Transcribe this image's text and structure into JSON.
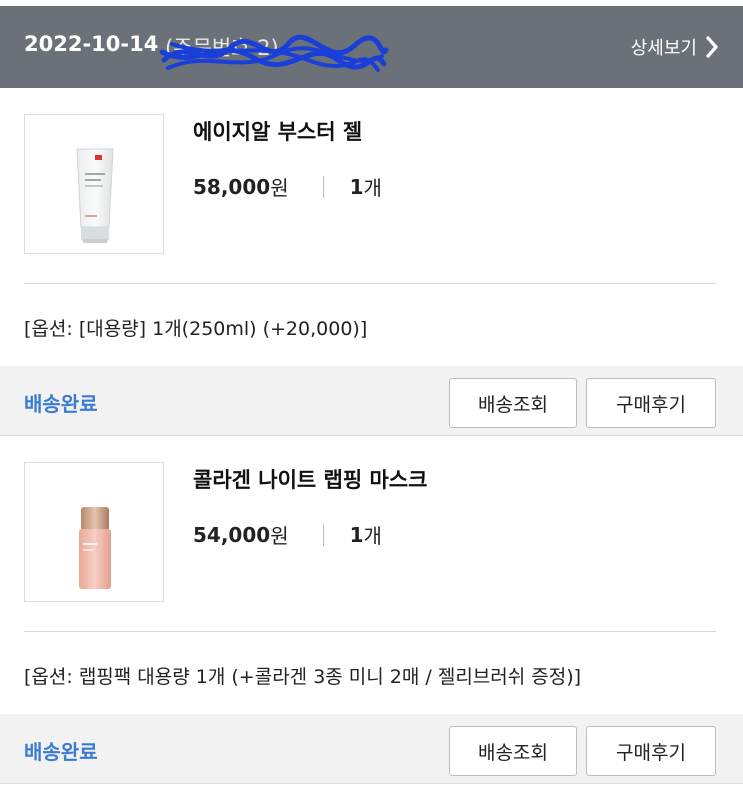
{
  "order": {
    "date": "2022-10-14",
    "order_number": "(주문번호 2)",
    "detail_label": "상세보기"
  },
  "items": [
    {
      "name": "에이지알 부스터 젤",
      "price": "58,000",
      "price_unit": "원",
      "quantity": "1",
      "quantity_unit": "개",
      "option": "[옵션: [대용량] 1개(250ml) (+20,000)]",
      "status": "배송완료",
      "track_label": "배송조회",
      "review_label": "구매후기"
    },
    {
      "name": "콜라겐 나이트 랩핑 마스크",
      "price": "54,000",
      "price_unit": "원",
      "quantity": "1",
      "quantity_unit": "개",
      "option": "[옵션: 랩핑팩 대용량 1개 (+콜라겐 3종 미니 2매 / 젤리브러쉬 증정)]",
      "status": "배송완료",
      "track_label": "배송조회",
      "review_label": "구매후기"
    }
  ],
  "colors": {
    "header_bg": "#6b7178",
    "status_blue": "#3a7bd5",
    "status_bar_bg": "#f2f2f2",
    "redaction_blue": "#1a3fd8"
  },
  "icons": {
    "detail_arrow": "chevron-right-icon"
  }
}
